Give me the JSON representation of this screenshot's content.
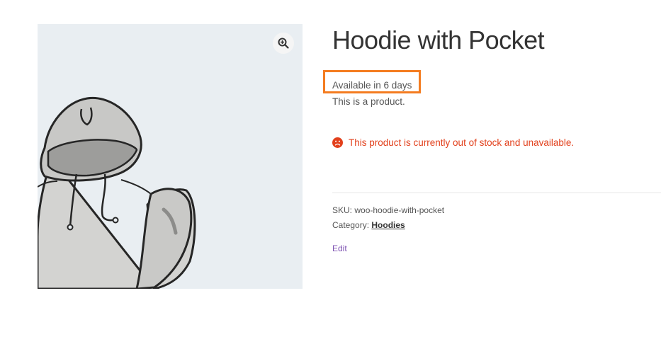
{
  "product": {
    "title": "Hoodie with Pocket",
    "availability": "Available in 6 days",
    "short_description": "This is a product.",
    "stock_notice": "This product is currently out of stock and unavailable.",
    "sku_label": "SKU:",
    "sku_value": "woo-hoodie-with-pocket",
    "category_label": "Category:",
    "category_value": "Hoodies",
    "edit_label": "Edit"
  },
  "gallery": {
    "image_subject": "hoodie-illustration",
    "zoom_icon": "magnifier-zoom-icon"
  },
  "colors": {
    "title": "#333333",
    "highlight_border": "#f47c20",
    "stock_alert": "#e2401c",
    "edit_link": "#7f54b3",
    "image_background": "#e9eef2"
  },
  "icons": {
    "stock_alert": "sad-face-icon"
  }
}
